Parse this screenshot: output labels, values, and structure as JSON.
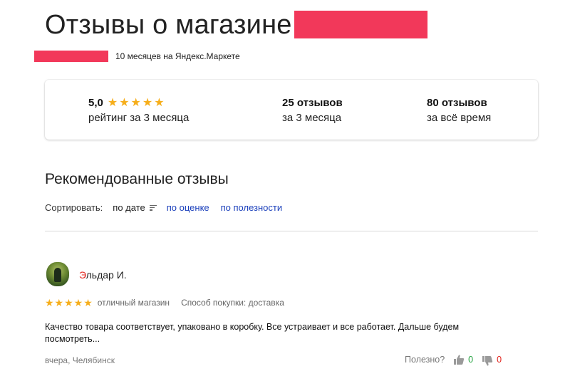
{
  "header": {
    "title": "Отзывы о магазине",
    "seller_meta": "10 месяцев на Яндекс.Маркете"
  },
  "stats": {
    "rating_value": "5,0",
    "rating_stars": "★★★★★",
    "rating_label": "рейтинг за 3 месяца",
    "recent_count": "25 отзывов",
    "recent_label": "за 3 месяца",
    "total_count": "80 отзывов",
    "total_label": "за всё время"
  },
  "section": {
    "title": "Рекомендованные отзывы"
  },
  "sort": {
    "label": "Сортировать:",
    "options": [
      "по дате",
      "по оценке",
      "по полезности"
    ],
    "active": "по дате"
  },
  "review": {
    "author_first_letter": "Э",
    "author_rest": "льдар И.",
    "stars": "★★★★★",
    "verdict": "отличный магазин",
    "purchase_method": "Способ покупки: доставка",
    "text": "Качество товара соответствует, упаковано в коробку. Все устраивает и все работает. Дальше будем посмотреть...",
    "date_city": "вчера, Челябинск",
    "helpful_label": "Полезно?",
    "likes": "0",
    "dislikes": "0"
  },
  "colors": {
    "star": "#f6ae1b",
    "link": "#1a3fbb",
    "like": "#22a23e",
    "dislike": "#e2221b",
    "redaction": "#f2385a"
  }
}
